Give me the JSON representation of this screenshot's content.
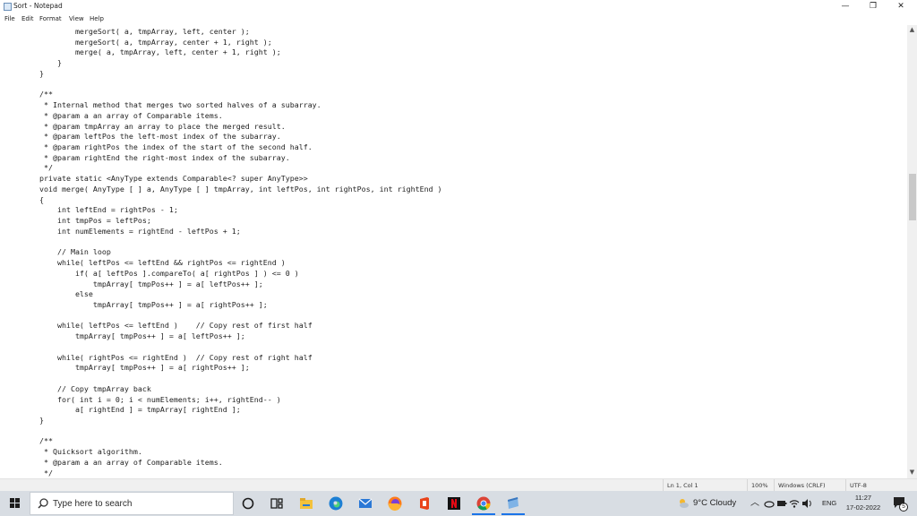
{
  "window": {
    "title": "Sort - Notepad",
    "controls": {
      "minimize": "—",
      "maximize": "❐",
      "close": "✕"
    }
  },
  "menu": [
    "File",
    "Edit",
    "Format",
    "View",
    "Help"
  ],
  "code_lines": [
    "            mergeSort( a, tmpArray, left, center );",
    "            mergeSort( a, tmpArray, center + 1, right );",
    "            merge( a, tmpArray, left, center + 1, right );",
    "        }",
    "    }",
    "",
    "    /**",
    "     * Internal method that merges two sorted halves of a subarray.",
    "     * @param a an array of Comparable items.",
    "     * @param tmpArray an array to place the merged result.",
    "     * @param leftPos the left-most index of the subarray.",
    "     * @param rightPos the index of the start of the second half.",
    "     * @param rightEnd the right-most index of the subarray.",
    "     */",
    "    private static <AnyType extends Comparable<? super AnyType>>",
    "    void merge( AnyType [ ] a, AnyType [ ] tmpArray, int leftPos, int rightPos, int rightEnd )",
    "    {",
    "        int leftEnd = rightPos - 1;",
    "        int tmpPos = leftPos;",
    "        int numElements = rightEnd - leftPos + 1;",
    "",
    "        // Main loop",
    "        while( leftPos <= leftEnd && rightPos <= rightEnd )",
    "            if( a[ leftPos ].compareTo( a[ rightPos ] ) <= 0 )",
    "                tmpArray[ tmpPos++ ] = a[ leftPos++ ];",
    "            else",
    "                tmpArray[ tmpPos++ ] = a[ rightPos++ ];",
    "",
    "        while( leftPos <= leftEnd )    // Copy rest of first half",
    "            tmpArray[ tmpPos++ ] = a[ leftPos++ ];",
    "",
    "        while( rightPos <= rightEnd )  // Copy rest of right half",
    "            tmpArray[ tmpPos++ ] = a[ rightPos++ ];",
    "",
    "        // Copy tmpArray back",
    "        for( int i = 0; i < numElements; i++, rightEnd-- )",
    "            a[ rightEnd ] = tmpArray[ rightEnd ];",
    "    }",
    "",
    "    /**",
    "     * Quicksort algorithm.",
    "     * @param a an array of Comparable items.",
    "     */"
  ],
  "status": {
    "position": "Ln 1, Col 1",
    "zoom": "100%",
    "line_ending": "Windows (CRLF)",
    "encoding": "UTF-8"
  },
  "taskbar": {
    "search_placeholder": "Type here to search",
    "apps": [
      "cortana-icon",
      "task-view-icon",
      "file-explorer-icon",
      "edge-icon",
      "mail-icon",
      "firefox-icon",
      "office-icon",
      "netflix-icon",
      "chrome-icon",
      "notepad-icon"
    ],
    "weather": "9°C  Cloudy",
    "language": "ENG",
    "time": "11:27",
    "date": "17-02-2022",
    "notification_count": "5"
  },
  "colors": {
    "taskbar_bg": "#d8dde3",
    "active_app_indicator": "#1a73e8"
  }
}
